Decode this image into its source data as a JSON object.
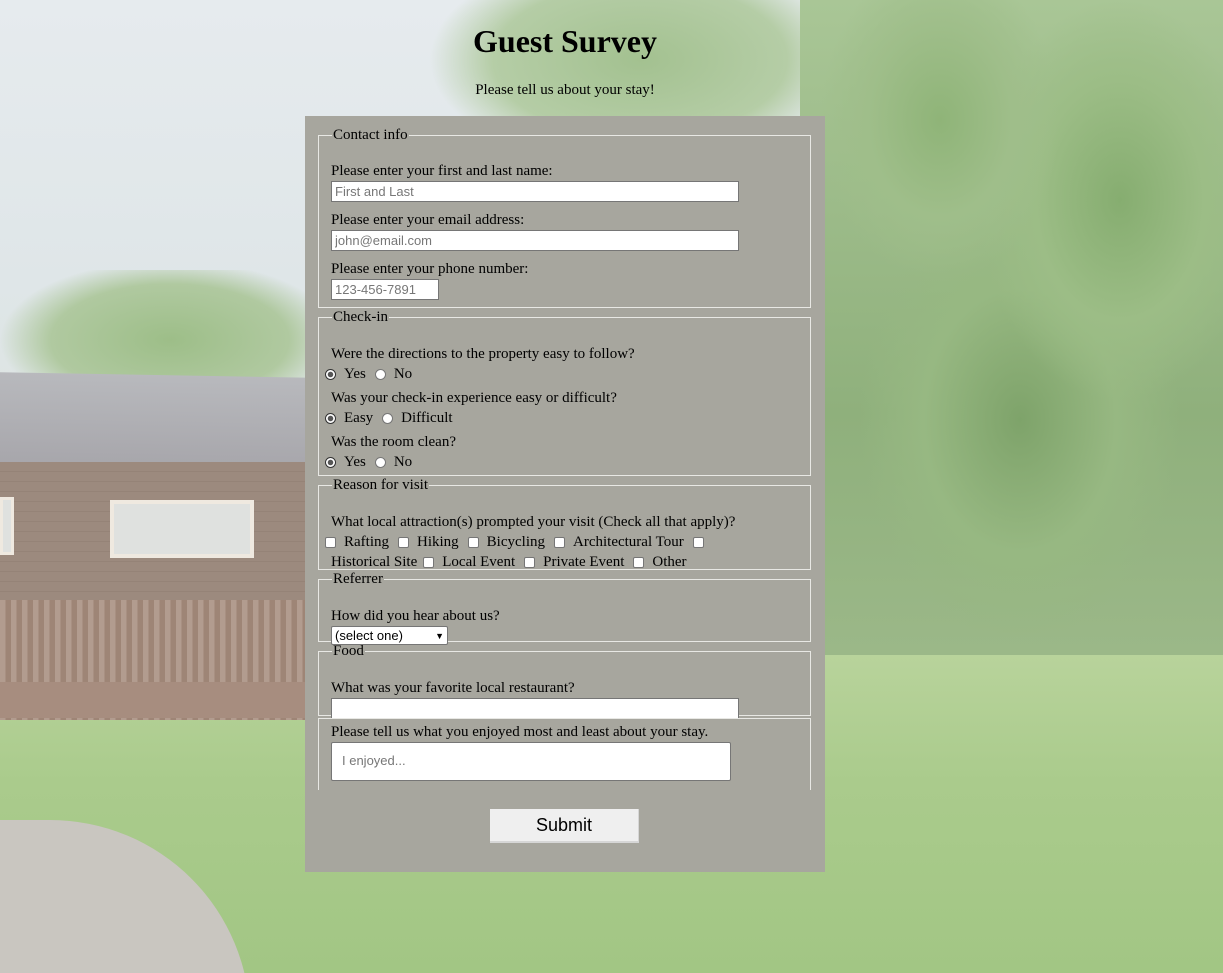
{
  "page": {
    "title": "Guest Survey",
    "subtitle": "Please tell us about your stay!"
  },
  "contact": {
    "legend": "Contact info",
    "name_label": "Please enter your first and last name:",
    "name_placeholder": "First and Last",
    "email_label": "Please enter your email address:",
    "email_placeholder": "john@email.com",
    "phone_label": "Please enter your phone number:",
    "phone_placeholder": "123-456-7891"
  },
  "checkin": {
    "legend": "Check-in",
    "q1": "Were the directions to the property easy to follow?",
    "q1_options": [
      "Yes",
      "No"
    ],
    "q2": "Was your check-in experience easy or difficult?",
    "q2_options": [
      "Easy",
      "Difficult"
    ],
    "q3": "Was the room clean?",
    "q3_options": [
      "Yes",
      "No"
    ]
  },
  "reason": {
    "legend": "Reason for visit",
    "question": "What local attraction(s) prompted your visit (Check all that apply)?",
    "options": [
      "Rafting",
      "Hiking",
      "Bicycling",
      "Architectural Tour",
      "Historical Site",
      "Local Event",
      "Private Event",
      "Other"
    ]
  },
  "referrer": {
    "legend": "Referrer",
    "question": "How did you hear about us?",
    "selected": "(select one)"
  },
  "food": {
    "legend": "Food",
    "question": "What was your favorite local restaurant?",
    "value": ""
  },
  "feedback": {
    "question": "Please tell us what you enjoyed most and least about your stay.",
    "placeholder": "I enjoyed..."
  },
  "submit_label": "Submit"
}
